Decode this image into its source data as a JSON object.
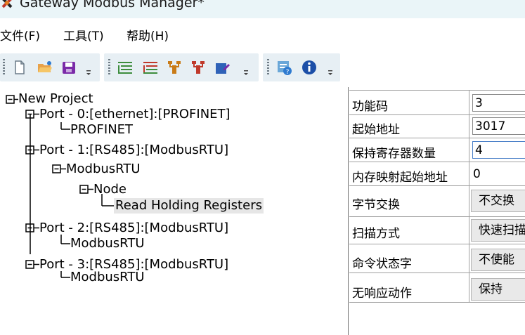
{
  "window": {
    "title": "Gateway Modbus Manager*"
  },
  "menu": {
    "items": [
      {
        "label": "文件(F)"
      },
      {
        "label": "工具(T)"
      },
      {
        "label": "帮助(H)"
      }
    ]
  },
  "toolbar": {
    "groups": [
      {
        "buttons": [
          "new-file-icon",
          "open-folder-icon",
          "save-icon"
        ]
      },
      {
        "buttons": [
          "add-port-icon",
          "delete-port-icon",
          "add-node-icon",
          "delete-node-icon",
          "edit-icon"
        ]
      },
      {
        "buttons": [
          "help-icon",
          "info-icon"
        ]
      }
    ]
  },
  "tree": {
    "nodes": [
      {
        "label": "New Project"
      },
      {
        "label": "Port - 0:[ethernet]:[PROFINET]"
      },
      {
        "label": "PROFINET"
      },
      {
        "label": "Port - 1:[RS485]:[ModbusRTU]"
      },
      {
        "label": "ModbusRTU"
      },
      {
        "label": "Node"
      },
      {
        "label": "Read Holding Registers"
      },
      {
        "label": "Port - 2:[RS485]:[ModbusRTU]"
      },
      {
        "label": "ModbusRTU"
      },
      {
        "label": "Port - 3:[RS485]:[ModbusRTU]"
      },
      {
        "label": "ModbusRTU"
      }
    ]
  },
  "properties": {
    "rows": [
      {
        "label": "功能码",
        "value": "3"
      },
      {
        "label": "起始地址",
        "value": "3017"
      },
      {
        "label": "保持寄存器数量",
        "value": "4"
      },
      {
        "label": "内存映射起始地址",
        "value": "0"
      },
      {
        "label": "字节交换",
        "value": "不交换"
      },
      {
        "label": "扫描方式",
        "value": "快速扫描"
      },
      {
        "label": "命令状态字",
        "value": "不使能"
      },
      {
        "label": "无响应动作",
        "value": "保持"
      }
    ]
  },
  "colors": {
    "titlebar_bg": "#eaf5f8",
    "toolbar_bg": "#e7eff4",
    "selection_bg": "#e6e6e6"
  }
}
